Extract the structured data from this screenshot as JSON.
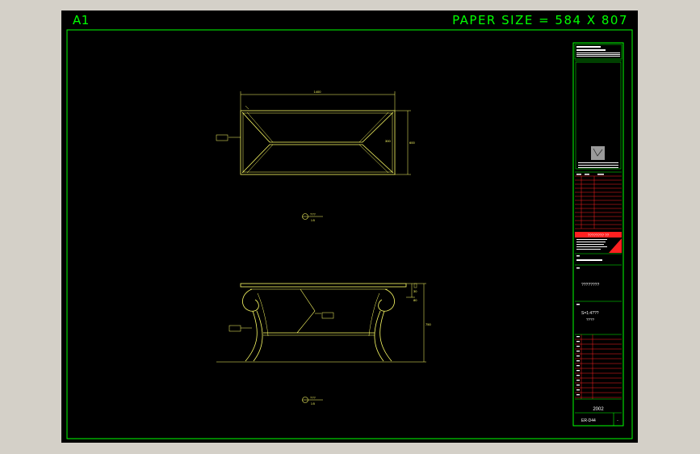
{
  "sheet": {
    "size_label": "A1",
    "paper_size": "PAPER SIZE = 584 X 807"
  },
  "colors": {
    "frame": "#00ff00",
    "geometry": "#ffff66",
    "title_block_red": "#ff2020",
    "background": "#000000"
  },
  "views": {
    "top": {
      "dim_width": "1400",
      "dim_height": "600",
      "dim_inner": "300",
      "section_mark": "???",
      "section_scale": "1:5"
    },
    "front": {
      "dim_top": "30",
      "dim_mid": "80",
      "dim_height": "750",
      "section_mark": "???",
      "section_scale": "1:5"
    }
  },
  "title_block": {
    "company_banner": "???????? ??",
    "name_note": "????????",
    "scale_note": "S=1:4???",
    "scale_sub": "????",
    "year": "2002",
    "drawing_no": "ER-D44",
    "sheet_no": "-"
  }
}
